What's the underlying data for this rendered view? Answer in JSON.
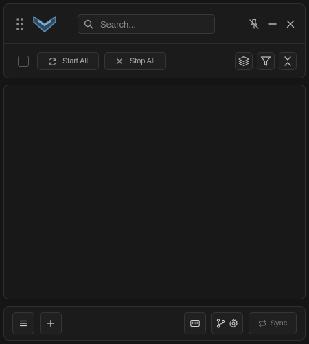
{
  "header": {
    "search": {
      "placeholder": "Search...",
      "value": ""
    },
    "icons": {
      "drag": "drag-handle-icon",
      "logo": "chevron-logo-icon",
      "pin": "unpin-icon",
      "minimize": "minimize-icon",
      "close": "close-icon"
    }
  },
  "toolbar": {
    "select_all_checked": false,
    "start_all_label": "Start All",
    "stop_all_label": "Stop All",
    "icons": {
      "start_all": "refresh-icon",
      "stop_all": "x-icon",
      "layers": "layers-icon",
      "filter": "filter-icon",
      "collapse": "collapse-icon"
    }
  },
  "main": {
    "items": []
  },
  "footer": {
    "sync_label": "Sync",
    "icons": {
      "menu": "menu-icon",
      "add": "plus-icon",
      "keyboard": "keyboard-icon",
      "git": "git-branch-icon",
      "settings": "gear-icon",
      "sync": "sync-icon"
    }
  },
  "colors": {
    "background": "#151515",
    "panel": "#1b1b1b",
    "border": "#2f2f2f",
    "logo_accent": "#5b8fb4",
    "logo_dark": "#2e4a63"
  }
}
